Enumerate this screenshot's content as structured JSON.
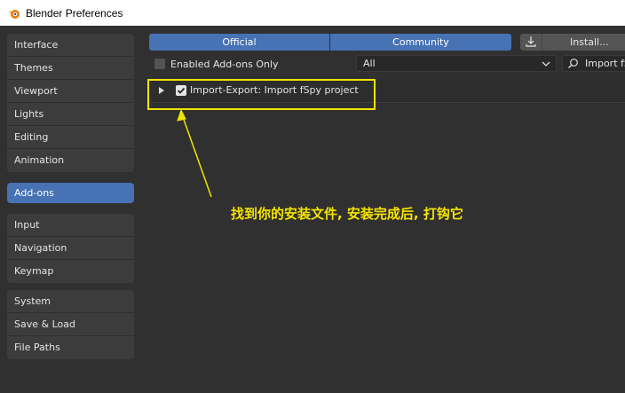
{
  "window": {
    "title": "Blender Preferences"
  },
  "sidebar": {
    "groups": [
      {
        "items": [
          {
            "label": "Interface"
          },
          {
            "label": "Themes"
          },
          {
            "label": "Viewport"
          },
          {
            "label": "Lights"
          },
          {
            "label": "Editing"
          },
          {
            "label": "Animation"
          }
        ]
      },
      {
        "items": [
          {
            "label": "Add-ons"
          }
        ],
        "active": true
      },
      {
        "items": [
          {
            "label": "Input"
          },
          {
            "label": "Navigation"
          },
          {
            "label": "Keymap"
          }
        ]
      },
      {
        "items": [
          {
            "label": "System"
          },
          {
            "label": "Save & Load"
          },
          {
            "label": "File Paths"
          }
        ]
      }
    ]
  },
  "toolbar": {
    "official_label": "Official",
    "community_label": "Community",
    "install_label": "Install..."
  },
  "filters": {
    "enabled_only_label": "Enabled Add-ons Only",
    "category_value": "All",
    "search_value": "Import fS"
  },
  "addons": [
    {
      "name": "Import-Export: Import fSpy project",
      "enabled": true
    }
  ],
  "annotation": {
    "text": "找到你的安装文件, 安装完成后, 打钩它"
  },
  "colors": {
    "accent": "#4772b3",
    "highlight": "#f0e500",
    "background": "#303030"
  }
}
